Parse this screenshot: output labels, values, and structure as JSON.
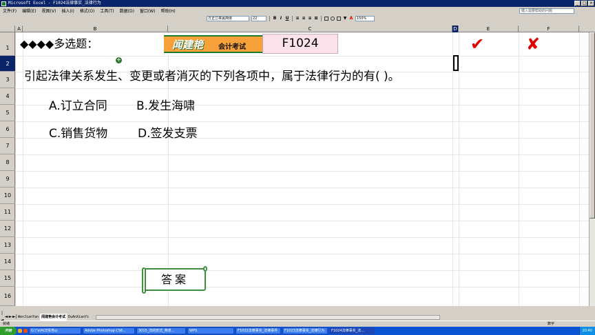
{
  "window": {
    "title": "Microsoft Excel - F1024法律事实_法律行为",
    "controls": [
      "_",
      "□",
      "×"
    ]
  },
  "menu": {
    "items": [
      "文件(F)",
      "编辑(E)",
      "视图(V)",
      "插入(I)",
      "格式(O)",
      "工具(T)",
      "数据(D)",
      "窗口(W)",
      "帮助(H)"
    ],
    "help_placeholder": "键入需要帮助的问题"
  },
  "toolbar": {
    "font_name": "方正兰亭黑简体",
    "font_size": "22",
    "zoom": "150%",
    "bold": "B",
    "italic": "I",
    "underline": "U"
  },
  "columns": [
    "A",
    "B",
    "C",
    "D",
    "E",
    "F"
  ],
  "rows": [
    "1",
    "2",
    "3",
    "4",
    "5",
    "6",
    "7",
    "8",
    "9",
    "10",
    "11",
    "12",
    "13",
    "14",
    "15",
    "16"
  ],
  "sheet": {
    "section_title": "◆◆◆◆多选题：",
    "logo_brand": "闻建艳",
    "logo_sub": "会计考试",
    "code": "F1024",
    "check_mark": "✔",
    "cross_mark": "✘",
    "question": "引起法律关系发生、变更或者消灭的下列各项中，属于法律行为的有(        )。",
    "options": {
      "a": "A.订立合同",
      "b": "B.发生海啸",
      "c": "C.销售货物",
      "d": "D.签发支票"
    },
    "answer_button": "答案"
  },
  "tabs": {
    "nav": [
      "|◄",
      "◄",
      "►",
      "►|"
    ],
    "items": [
      "WenJianYan",
      "闻建艳会计考试",
      "DuAnXiaoYi"
    ]
  },
  "status": {
    "ready": "就绪",
    "mode": "数字"
  },
  "taskbar": {
    "start": "开始",
    "tasks": [
      "G:\\\"e\\ACE实务◎",
      "Adobe Photoshop CS6...",
      "3015_法的形式_简单...",
      "WPS",
      "F1022法律事实_法律事件",
      "F1023法律事实_法律行为",
      "F1024法律事实_法..."
    ],
    "clock": "20:40"
  }
}
